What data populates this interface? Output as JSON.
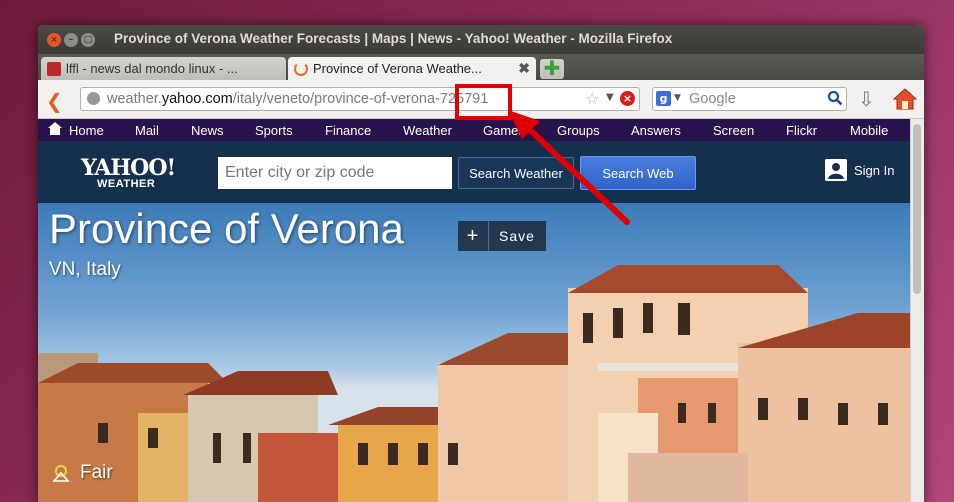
{
  "window": {
    "title": "Province of Verona Weather Forecasts | Maps | News - Yahoo! Weather - Mozilla Firefox",
    "close_glyph": "×",
    "min_glyph": "–",
    "max_glyph": "□"
  },
  "tabs": [
    {
      "label": "lffl - news dal mondo linux - ...",
      "active": false
    },
    {
      "label": "Province of Verona Weathe...",
      "active": true
    }
  ],
  "tab_close_glyph": "✖",
  "new_tab_glyph": "✚",
  "urlbar": {
    "prefix": "weather.",
    "domain": "yahoo.com",
    "path": "/italy/veneto/province-of-verona-725791",
    "stop_glyph": "×"
  },
  "search": {
    "engine": "g",
    "placeholder": "Google"
  },
  "yahoo_nav": {
    "items": [
      "Home",
      "Mail",
      "News",
      "Sports",
      "Finance",
      "Weather",
      "Games",
      "Groups",
      "Answers",
      "Screen",
      "Flickr",
      "Mobile"
    ]
  },
  "yahoo_header": {
    "logo": "YAHOO!",
    "logo_sub": "WEATHER",
    "city_placeholder": "Enter city or zip code",
    "search_weather_label": "Search Weather",
    "search_web_label": "Search Web",
    "signin_label": "Sign In"
  },
  "location": {
    "title": "Province of Verona",
    "region": "VN, Italy",
    "save_plus": "+",
    "save_label": "Save",
    "condition": "Fair"
  },
  "colors": {
    "accent_red": "#e00000",
    "yahoo_purple": "#28134d",
    "yahoo_blue": "#15304f"
  }
}
